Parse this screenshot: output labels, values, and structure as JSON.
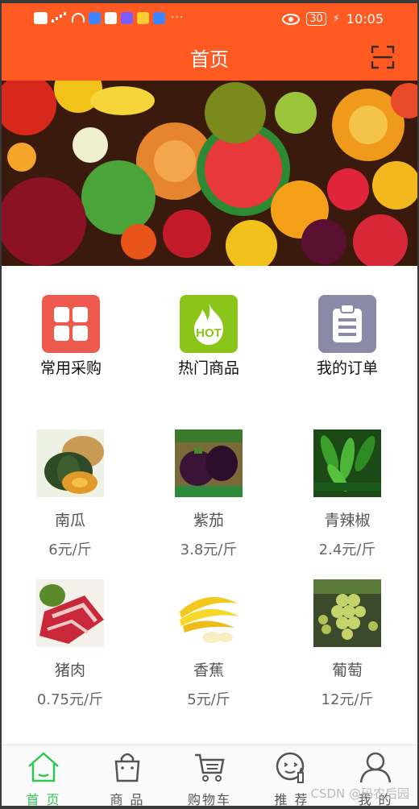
{
  "status_bar": {
    "time": "10:05",
    "battery": "30",
    "dots": "···"
  },
  "header": {
    "title": "首页"
  },
  "menu": [
    {
      "label": "常用采购",
      "icon": "grid-icon",
      "color": "#ef5a4f"
    },
    {
      "label": "热门商品",
      "icon": "hot-fire-icon",
      "color": "#8cc51a"
    },
    {
      "label": "我的订单",
      "icon": "clipboard-icon",
      "color": "#8a8aa8"
    }
  ],
  "products": [
    {
      "name": "南瓜",
      "price": "6元/斤"
    },
    {
      "name": "紫茄",
      "price": "3.8元/斤"
    },
    {
      "name": "青辣椒",
      "price": "2.4元/斤"
    },
    {
      "name": "猪肉",
      "price": "0.75元/斤"
    },
    {
      "name": "香蕉",
      "price": "5元/斤"
    },
    {
      "name": "葡萄",
      "price": "12元/斤"
    }
  ],
  "tabs": [
    {
      "label": "首 页",
      "active": true,
      "icon": "home-icon"
    },
    {
      "label": "商 品",
      "active": false,
      "icon": "bag-icon"
    },
    {
      "label": "购物车",
      "active": false,
      "icon": "cart-icon"
    },
    {
      "label": "推 荐",
      "active": false,
      "icon": "recommend-icon"
    },
    {
      "label": "我 的",
      "active": false,
      "icon": "user-icon"
    }
  ],
  "watermark": "CSDN @码农后园",
  "colors": {
    "brand": "#ff5a22",
    "active_tab": "#2fc652"
  }
}
